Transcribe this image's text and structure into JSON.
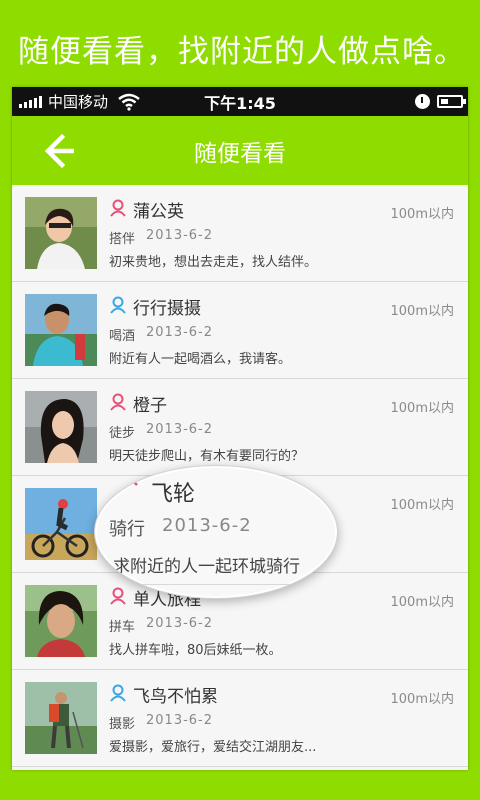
{
  "promo_text": "随便看看，找附近的人做点啥。",
  "status_bar": {
    "carrier": "中国移动",
    "time": "下午1:45"
  },
  "nav": {
    "title": "随便看看"
  },
  "colors": {
    "brand_green": "#8fdc00",
    "female_pink": "#e8507a",
    "male_blue": "#3aa8e0"
  },
  "items": [
    {
      "name": "蒲公英",
      "gender": "female",
      "distance": "100m以内",
      "tag": "搭伴",
      "date": "2013-6-2",
      "desc": "初来贵地，想出去走走，找人结伴。"
    },
    {
      "name": "行行摄摄",
      "gender": "male",
      "distance": "100m以内",
      "tag": "喝酒",
      "date": "2013-6-2",
      "desc": "附近有人一起喝酒么，我请客。"
    },
    {
      "name": "橙子",
      "gender": "female",
      "distance": "100m以内",
      "tag": "徒步",
      "date": "2013-6-2",
      "desc": "明天徒步爬山，有木有要同行的？"
    },
    {
      "name": "飞轮",
      "gender": "female",
      "distance": "100m以内",
      "tag": "骑行",
      "date": "2013-6-2",
      "desc": "求附近的人一起环城骑行"
    },
    {
      "name": "单人旅程",
      "gender": "female",
      "distance": "100m以内",
      "tag": "拼车",
      "date": "2013-6-2",
      "desc": "找人拼车啦，80后妹纸一枚。"
    },
    {
      "name": "飞鸟不怕累",
      "gender": "male",
      "distance": "100m以内",
      "tag": "摄影",
      "date": "2013-6-2",
      "desc": "爱摄影，爱旅行，爱结交江湖朋友..."
    }
  ]
}
